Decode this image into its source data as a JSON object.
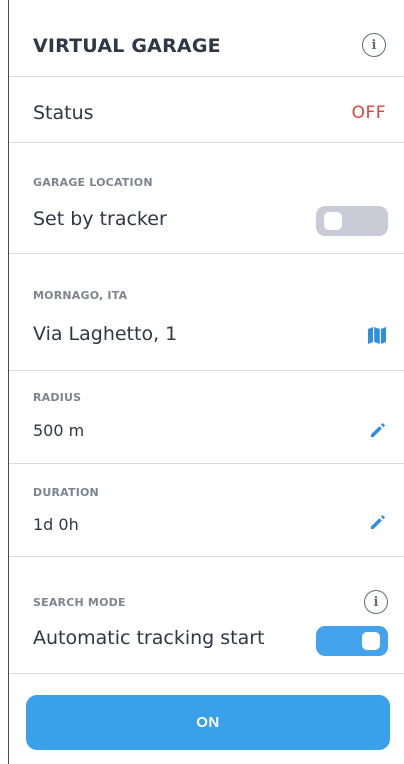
{
  "header": {
    "title": "VIRTUAL GARAGE",
    "info_icon": "info-icon"
  },
  "status": {
    "label": "Status",
    "value": "OFF",
    "value_color": "#e2403f"
  },
  "garage_location": {
    "label": "GARAGE LOCATION",
    "option_label": "Set by tracker",
    "toggle_state": "off"
  },
  "address": {
    "label": "MORNAGO, ITA",
    "value": "Via Laghetto, 1",
    "icon": "map-icon"
  },
  "radius": {
    "label": "RADIUS",
    "value": "500 m",
    "icon": "edit-icon"
  },
  "duration": {
    "label": "DURATION",
    "value": "1d 0h",
    "icon": "edit-icon"
  },
  "search_mode": {
    "label": "SEARCH MODE",
    "option_label": "Automatic tracking start",
    "toggle_state": "on",
    "info_icon": "info-icon"
  },
  "action": {
    "button_label": "ON",
    "color": "#3aa0ea"
  }
}
